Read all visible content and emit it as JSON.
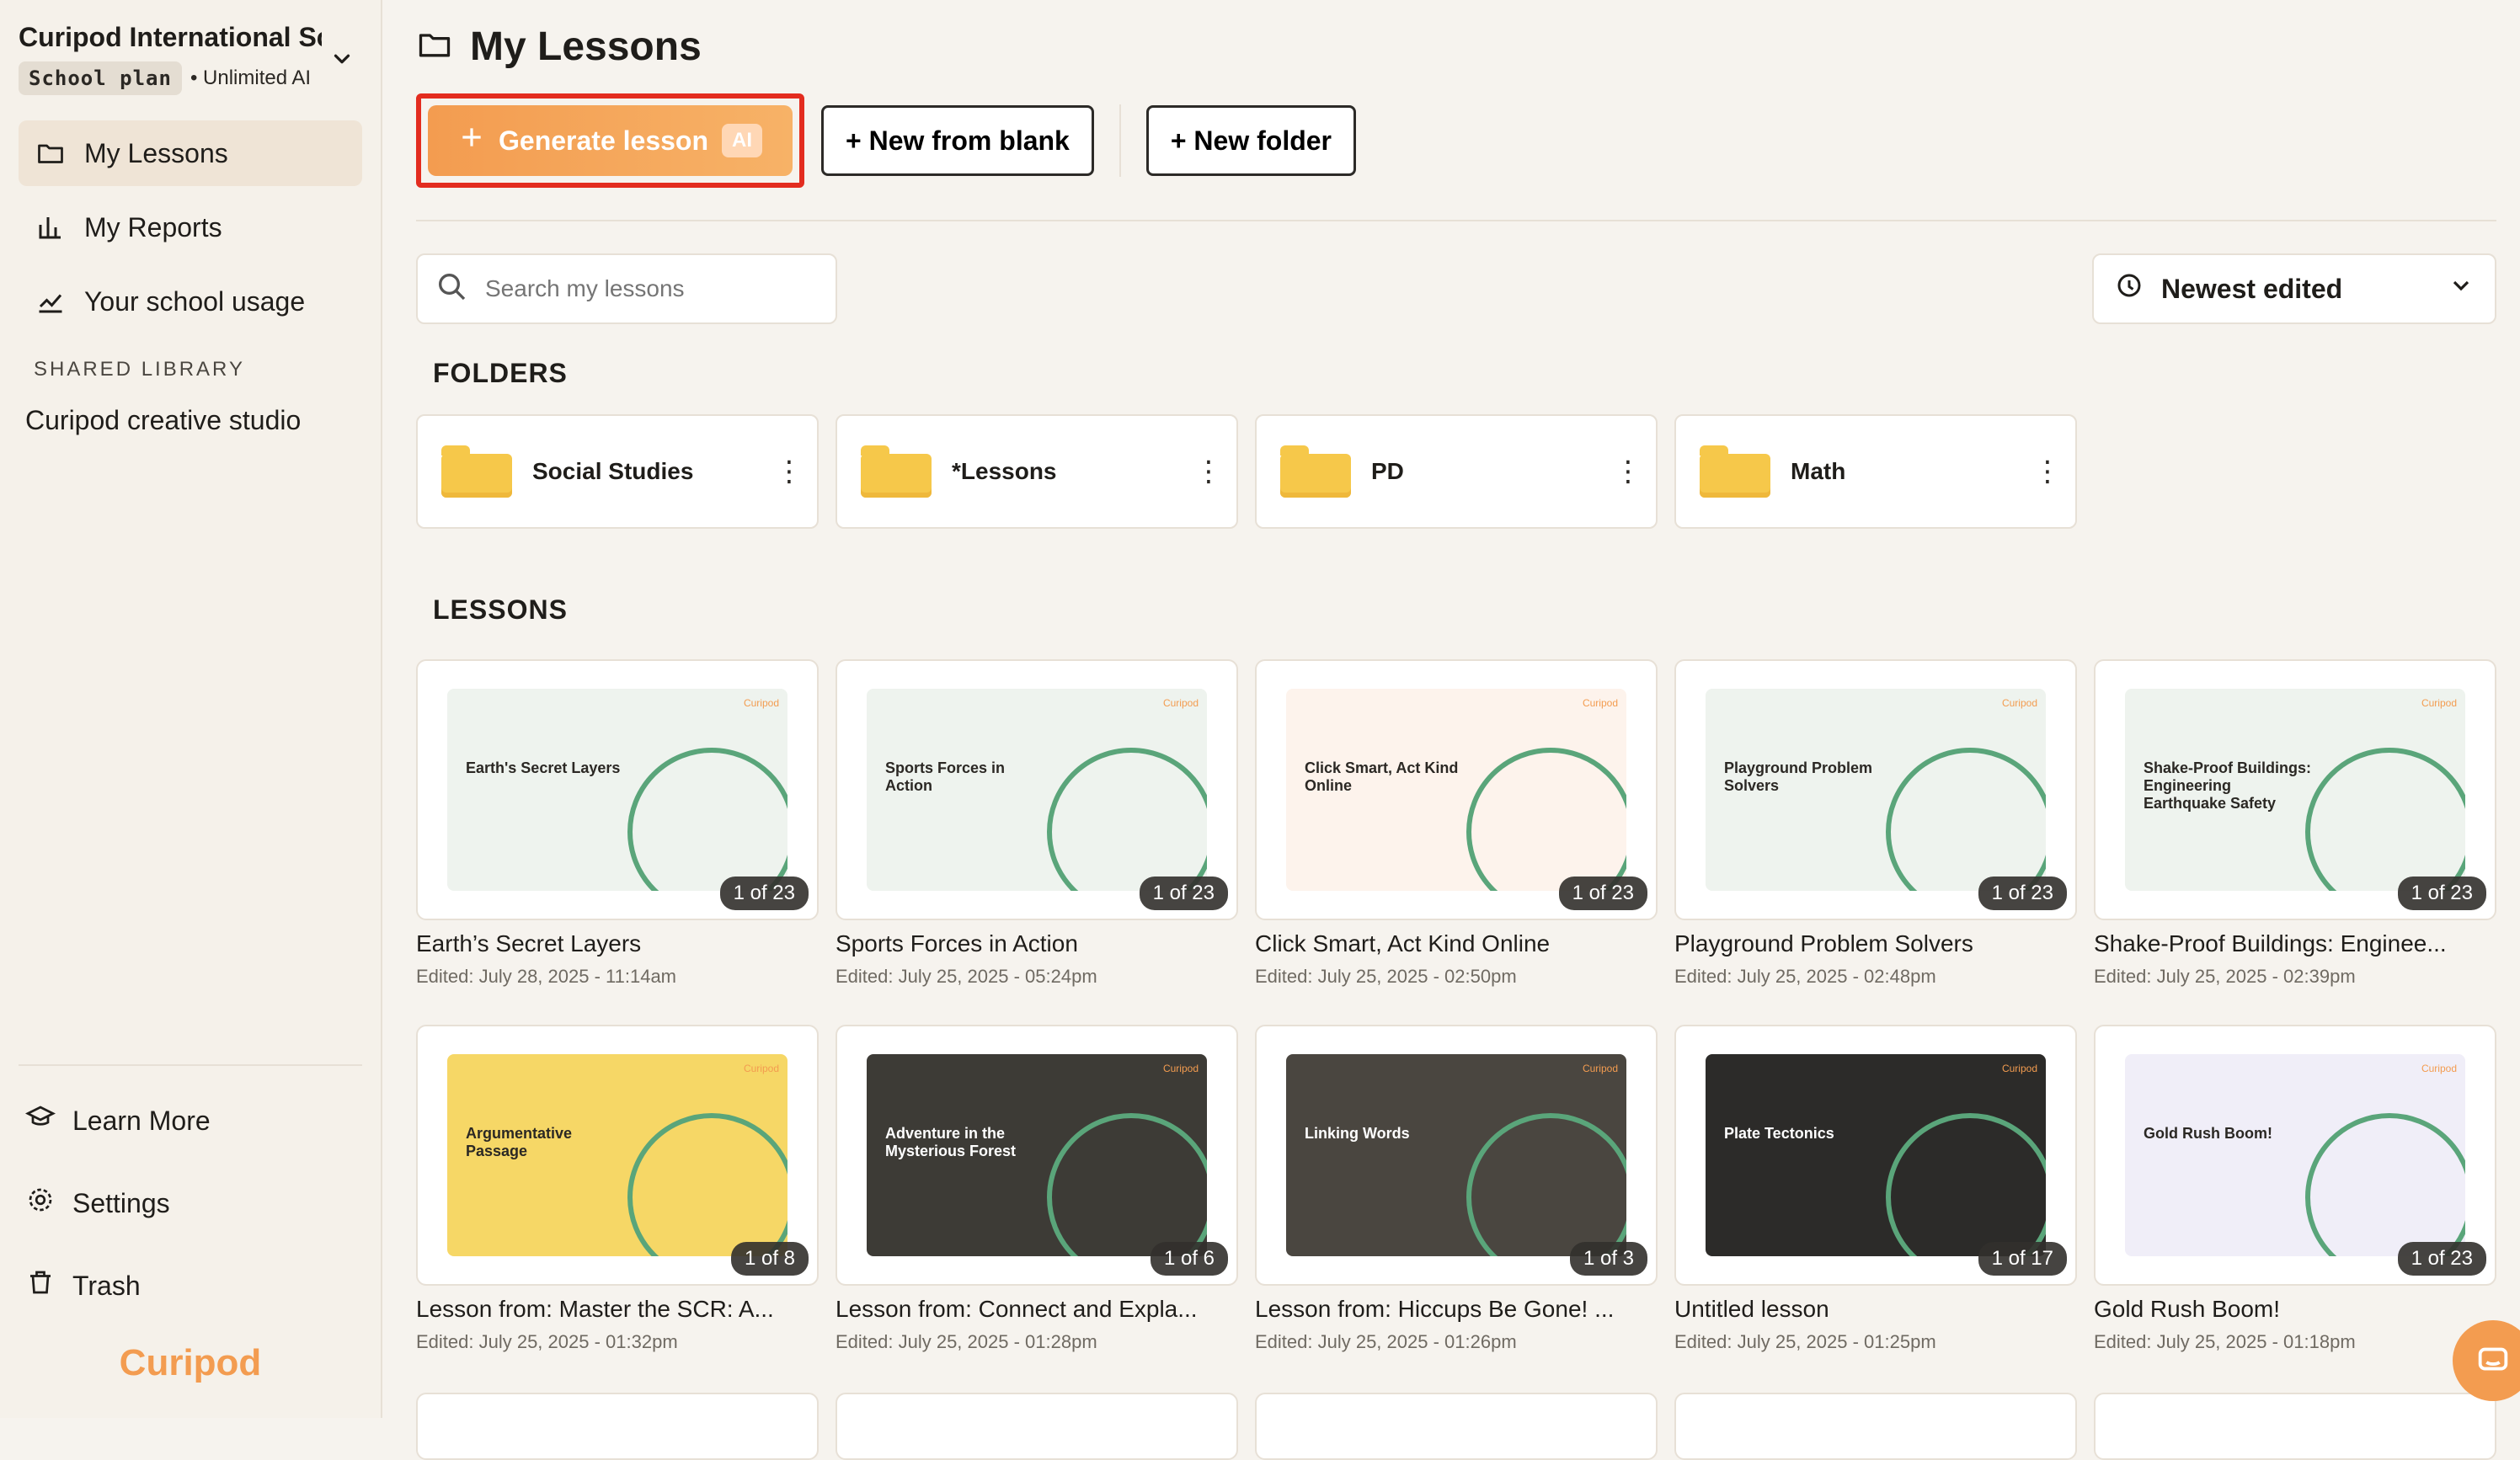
{
  "sidebar": {
    "org_name": "Curipod International Sc",
    "plan": "School plan",
    "plan_note": "• Unlimited AI",
    "nav": [
      {
        "label": "My Lessons",
        "icon": "folder-icon"
      },
      {
        "label": "My Reports",
        "icon": "bar-chart-icon"
      },
      {
        "label": "Your school usage",
        "icon": "trend-icon"
      }
    ],
    "shared_label": "SHARED LIBRARY",
    "studio": "Curipod creative studio",
    "bottom": [
      {
        "label": "Learn More",
        "icon": "graduation-cap-icon"
      },
      {
        "label": "Settings",
        "icon": "gear-icon"
      },
      {
        "label": "Trash",
        "icon": "trash-icon"
      }
    ],
    "logo": "Curipod"
  },
  "header": {
    "title": "My Lessons",
    "buttons": {
      "generate": "Generate lesson",
      "ai_badge": "AI",
      "new_blank": "+ New from blank",
      "new_folder": "+ New folder"
    },
    "search_placeholder": "Search my lessons",
    "sort_label": "Newest edited"
  },
  "sections": {
    "folders": "FOLDERS",
    "lessons": "LESSONS"
  },
  "folders": [
    {
      "name": "Social Studies"
    },
    {
      "name": "*Lessons"
    },
    {
      "name": "PD"
    },
    {
      "name": "Math"
    }
  ],
  "lessons": [
    {
      "title": "Earth’s Secret Layers",
      "edited": "Edited: July 28, 2025 - 11:14am",
      "count": "1 of 23",
      "slide_title": "Earth's Secret Layers",
      "bg": "#eef3ee"
    },
    {
      "title": "Sports Forces in Action",
      "edited": "Edited: July 25, 2025 - 05:24pm",
      "count": "1 of 23",
      "slide_title": "Sports Forces in Action",
      "bg": "#eef3ee"
    },
    {
      "title": "Click Smart, Act Kind Online",
      "edited": "Edited: July 25, 2025 - 02:50pm",
      "count": "1 of 23",
      "slide_title": "Click Smart, Act Kind Online",
      "bg": "#fdf3ec"
    },
    {
      "title": "Playground Problem Solvers",
      "edited": "Edited: July 25, 2025 - 02:48pm",
      "count": "1 of 23",
      "slide_title": "Playground Problem Solvers",
      "bg": "#eef3ee"
    },
    {
      "title": "Shake-Proof Buildings: Enginee...",
      "edited": "Edited: July 25, 2025 - 02:39pm",
      "count": "1 of 23",
      "slide_title": "Shake-Proof Buildings: Engineering Earthquake Safety",
      "bg": "#eef3ee"
    },
    {
      "title": "Lesson from: Master the SCR: A...",
      "edited": "Edited: July 25, 2025 - 01:32pm",
      "count": "1 of 8",
      "slide_title": "Argumentative Passage",
      "bg": "#f6d766"
    },
    {
      "title": "Lesson from: Connect and Expla...",
      "edited": "Edited: July 25, 2025 - 01:28pm",
      "count": "1 of 6",
      "slide_title": "Adventure in the Mysterious Forest",
      "bg": "#3d3b36"
    },
    {
      "title": "Lesson from: Hiccups Be Gone! ...",
      "edited": "Edited: July 25, 2025 - 01:26pm",
      "count": "1 of 3",
      "slide_title": "Linking Words",
      "bg": "#4a4640"
    },
    {
      "title": "Untitled lesson",
      "edited": "Edited: July 25, 2025 - 01:25pm",
      "count": "1 of 17",
      "slide_title": "Plate Tectonics",
      "bg": "#2c2b29"
    },
    {
      "title": "Gold Rush Boom!",
      "edited": "Edited: July 25, 2025 - 01:18pm",
      "count": "1 of 23",
      "slide_title": "Gold Rush Boom!",
      "bg": "#f0eef8"
    }
  ],
  "colors": {
    "accent": "#f39c50",
    "highlight": "#e32c1f"
  }
}
